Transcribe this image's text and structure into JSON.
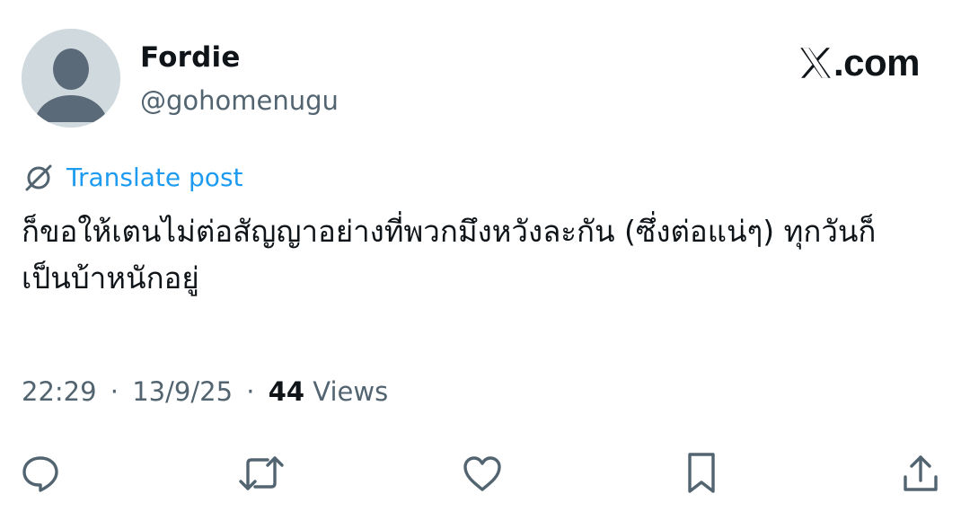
{
  "author": {
    "display_name": "Fordie",
    "handle": "@gohomenugu",
    "avatar_icon": "default-avatar-icon"
  },
  "brand": {
    "logo_icon": "x-logo-icon",
    "text": ".com"
  },
  "translate": {
    "icon": "globe-translate-icon",
    "label": "Translate post"
  },
  "post": {
    "text": "ก็ขอให้เตนไม่ต่อสัญญาอย่างที่พวกมึงหวังละกัน (ซึ่งต่อแน่ๆ) ทุกวันก็เป็นบ้าหนักอยู่"
  },
  "meta": {
    "time": "22:29",
    "separator": "·",
    "date": "13/9/25",
    "views_count": "44",
    "views_label": "Views"
  },
  "actions": [
    {
      "name": "reply",
      "icon": "reply-icon"
    },
    {
      "name": "repost",
      "icon": "repost-icon"
    },
    {
      "name": "like",
      "icon": "heart-icon"
    },
    {
      "name": "bookmark",
      "icon": "bookmark-icon"
    },
    {
      "name": "share",
      "icon": "share-icon"
    }
  ],
  "colors": {
    "link": "#1d9bf0",
    "secondary_text": "#536471",
    "primary_text": "#0f1419",
    "avatar_bg": "#cfd9de"
  }
}
